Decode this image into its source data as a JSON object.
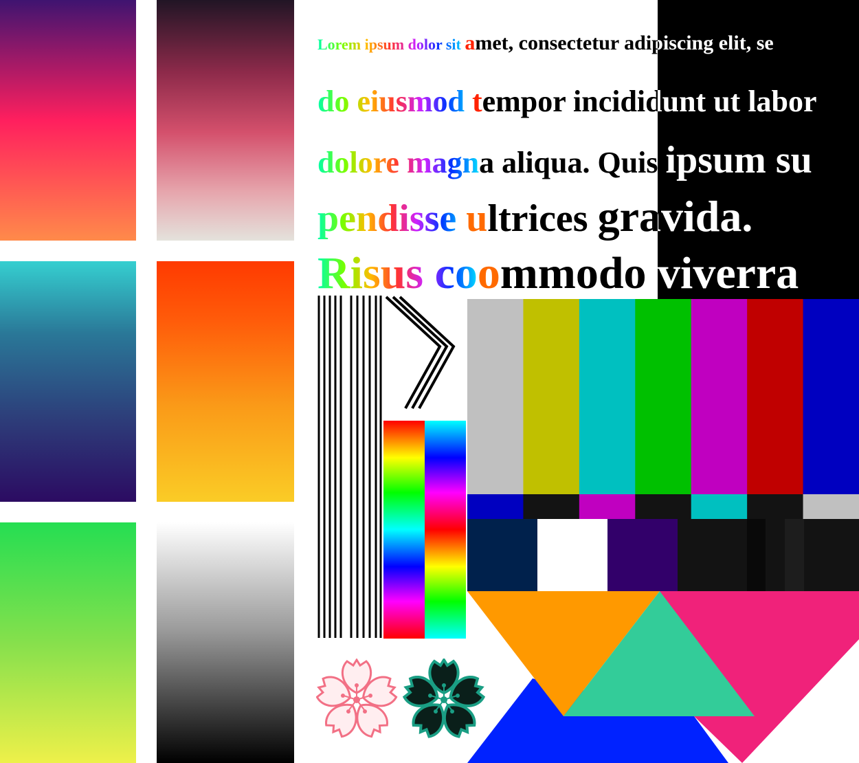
{
  "text": {
    "line1": [
      "Lorem ipsum dolor sit ",
      "a",
      "met, consectetur adipiscing elit,  se"
    ],
    "line2": [
      "do eiusmod ",
      "t",
      "empor incididunt ut labor"
    ],
    "line3": [
      "dolore magn",
      "a aliqua. Quis ",
      "ipsum su"
    ],
    "line4": [
      "pendisse ",
      "u",
      "ltrices ",
      "gravida."
    ],
    "line5": [
      "Risus co",
      "o",
      "mmodo viverra"
    ]
  },
  "colors": {
    "smpte_top": [
      "#c0c0c0",
      "#c0c000",
      "#00c0c0",
      "#00c000",
      "#c000c0",
      "#c00000",
      "#0000c0"
    ],
    "smpte_mid": [
      "#0000c0",
      "#131313",
      "#c000c0",
      "#131313",
      "#00c0c0",
      "#131313",
      "#c0c0c0"
    ],
    "smpte_bottom": [
      "#00214c",
      "#ffffff",
      "#32006a",
      "#131313",
      "#090909",
      "#131313",
      "#1d1d1d",
      "#131313"
    ],
    "triangles": [
      "#ff9900",
      "#33cc99",
      "#f0227a",
      "#0022ff"
    ],
    "flower_light": "#ffeef0",
    "flower_light_stroke": "#f27085",
    "flower_dark": "#0a1f1a",
    "flower_dark_stroke": "#1a9e84"
  },
  "icons": [
    "blossom-outline-icon",
    "blossom-filled-icon"
  ]
}
